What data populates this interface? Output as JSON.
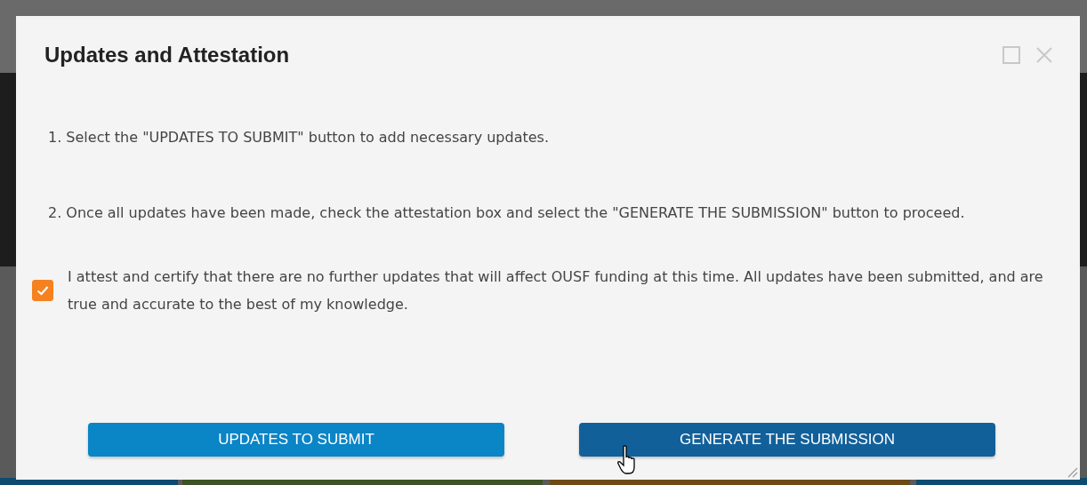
{
  "dialog": {
    "title": "Updates and Attestation",
    "instructions": [
      "1. Select the \"UPDATES TO SUBMIT\" button to add necessary updates.",
      "2. Once all updates have been made, check the attestation box and select the \"GENERATE THE SUBMISSION\" button to proceed."
    ],
    "attestation": {
      "checked": true,
      "text": "I attest and certify that there are no further updates that will affect OUSF funding at this time. All updates have been submitted, and are true and accurate to the best of my knowledge."
    },
    "buttons": [
      {
        "label": "UPDATES TO SUBMIT",
        "hovered": false
      },
      {
        "label": "GENERATE THE SUBMISSION",
        "hovered": true
      }
    ]
  }
}
